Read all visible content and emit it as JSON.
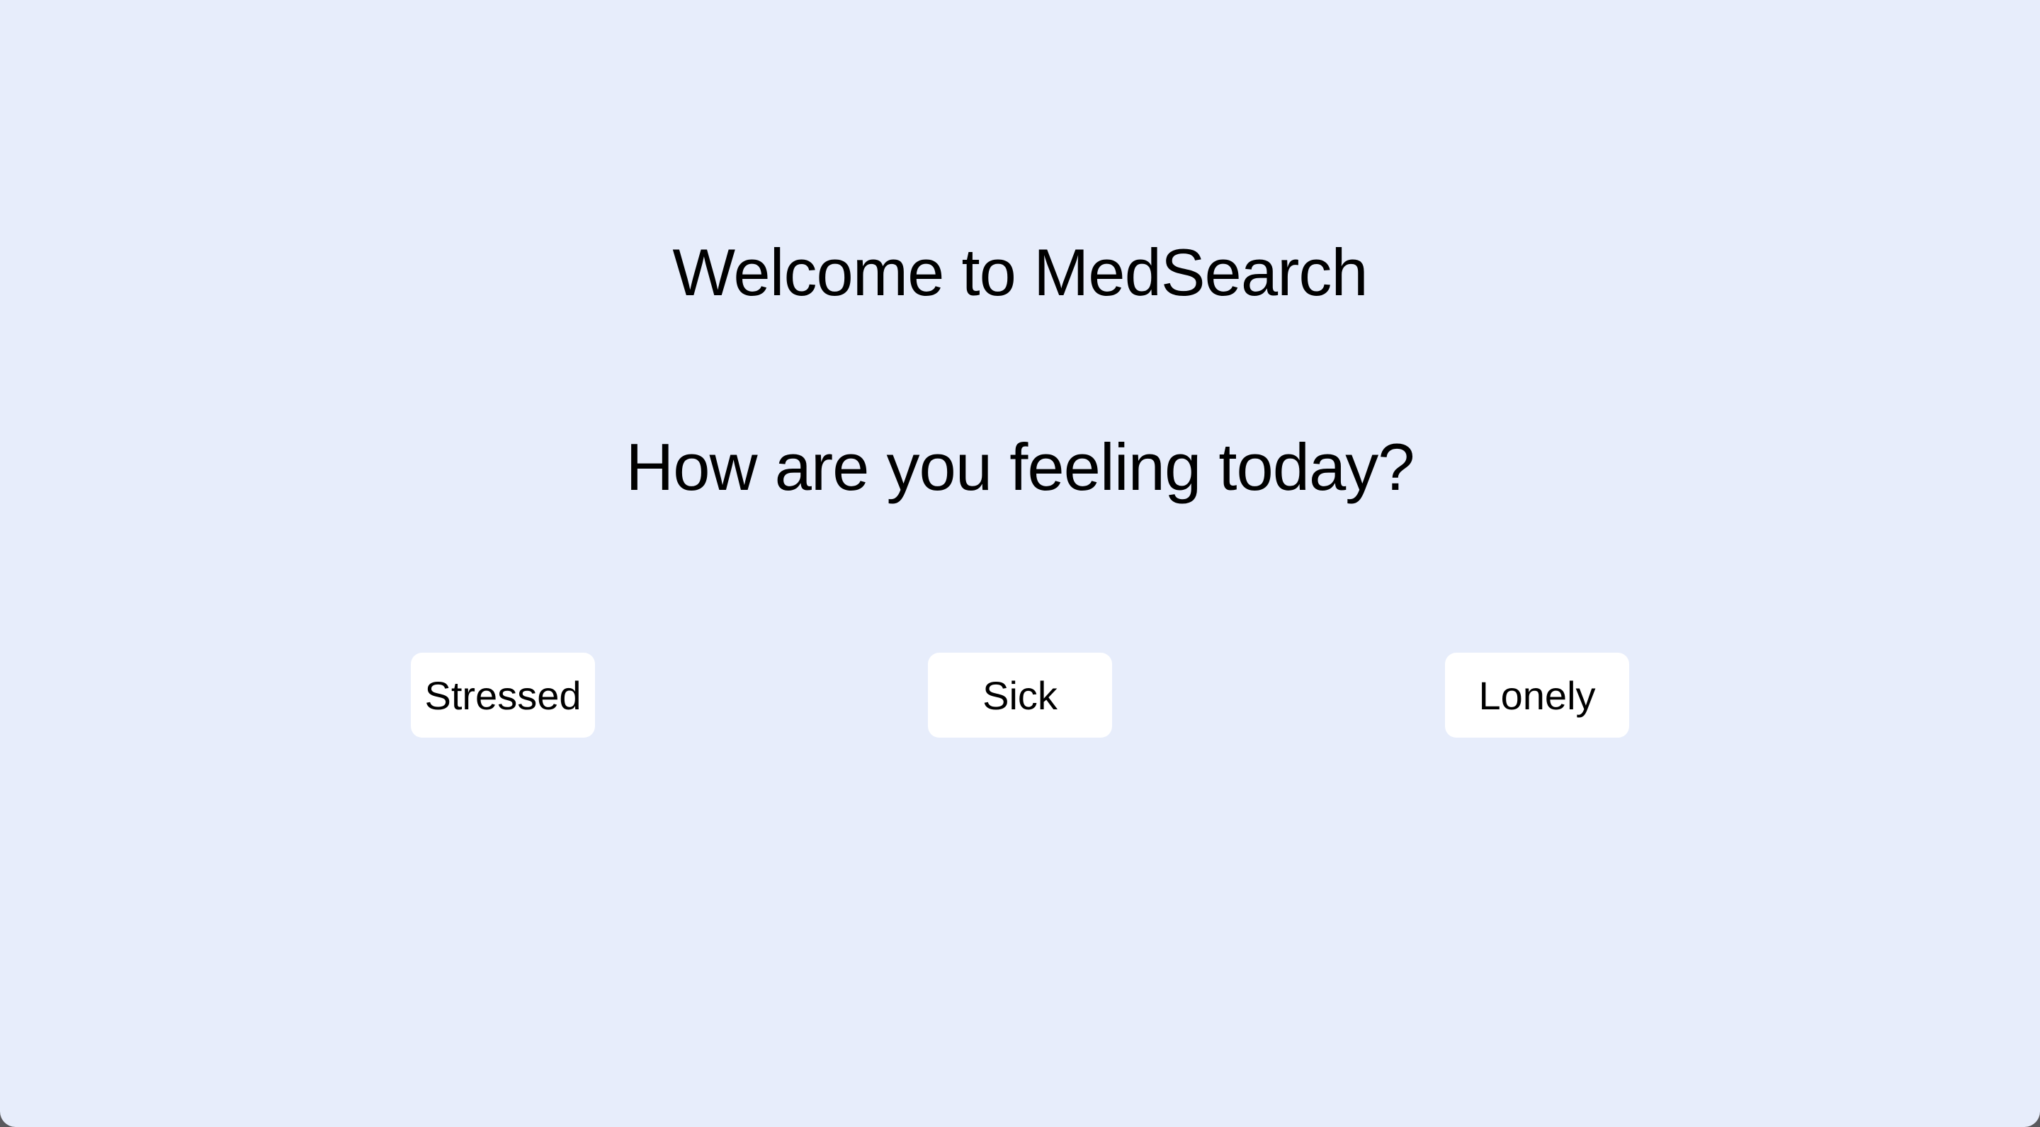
{
  "app": {
    "background_color": "#e7edfb",
    "button_color": "#ffffff",
    "text_color": "#000000"
  },
  "main": {
    "title": "Welcome to MedSearch",
    "question": "How are you feeling today?",
    "options": [
      {
        "label": "Stressed"
      },
      {
        "label": "Sick"
      },
      {
        "label": "Lonely"
      }
    ]
  }
}
